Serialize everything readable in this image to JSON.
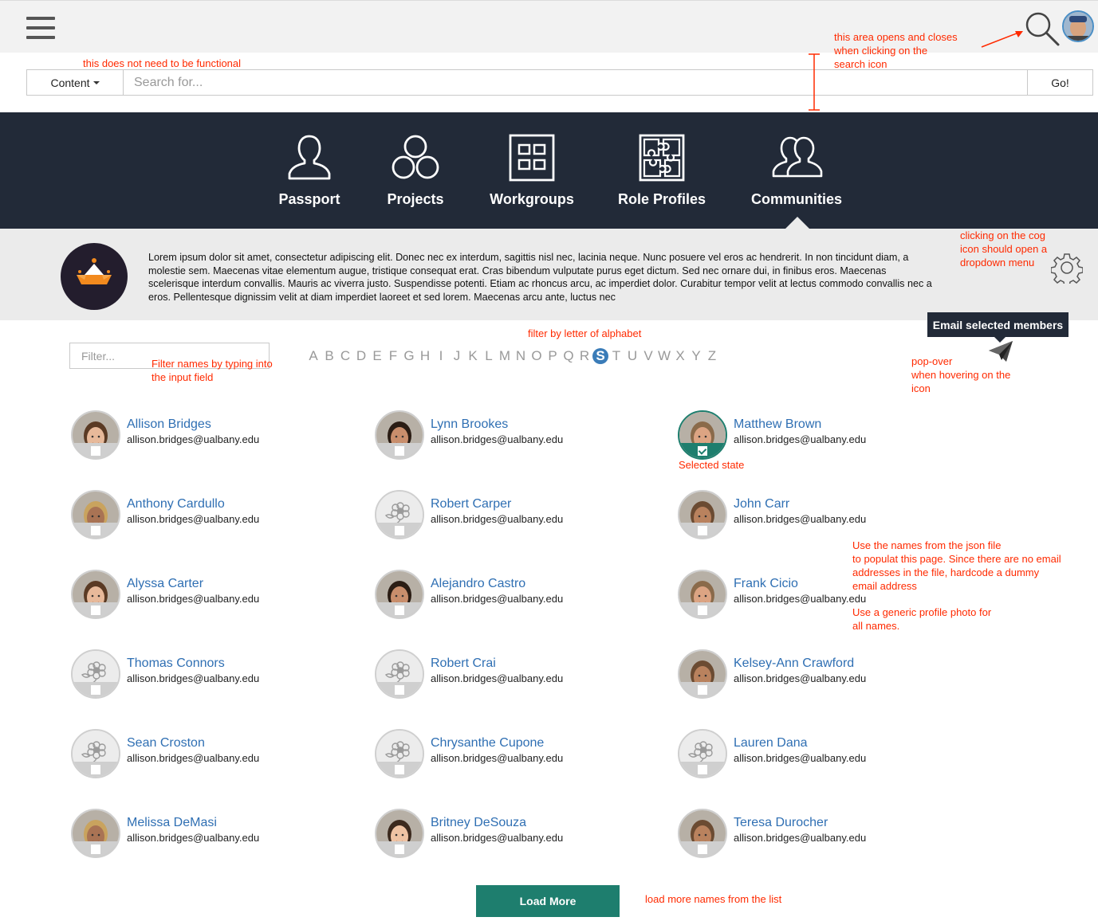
{
  "header": {
    "menu_icon": "hamburger-icon",
    "search_icon": "search-icon",
    "avatar_icon": "user-avatar"
  },
  "search": {
    "dropdown_label": "Content",
    "placeholder": "Search for...",
    "go_label": "Go!"
  },
  "nav": {
    "items": [
      {
        "label": "Passport",
        "icon": "person-icon"
      },
      {
        "label": "Projects",
        "icon": "circles-icon"
      },
      {
        "label": "Workgroups",
        "icon": "grid-icon"
      },
      {
        "label": "Role Profiles",
        "icon": "puzzle-icon"
      },
      {
        "label": "Communities",
        "icon": "people-icon"
      }
    ],
    "active": "Communities"
  },
  "community": {
    "description": "Lorem ipsum dolor sit amet, consectetur adipiscing elit. Donec nec ex interdum, sagittis nisl nec, lacinia neque. Nunc posuere vel eros ac hendrerit. In non tincidunt diam, a molestie sem. Maecenas vitae elementum augue, tristique consequat erat. Cras bibendum vulputate purus eget dictum. Sed nec ornare dui, in finibus eros. Maecenas scelerisque interdum convallis. Mauris ac viverra justo. Suspendisse potenti. Etiam ac rhoncus arcu, ac imperdiet dolor. Curabitur tempor velit at lectus commodo convallis nec a eros. Pellentesque dignissim velit at diam imperdiet laoreet et sed lorem. Maecenas arcu ante, luctus nec",
    "cog_icon": "gear-icon"
  },
  "filter": {
    "placeholder": "Filter...",
    "letters": [
      "A",
      "B",
      "C",
      "D",
      "E",
      "F",
      "G",
      "H",
      "I",
      "J",
      "K",
      "L",
      "M",
      "N",
      "O",
      "P",
      "Q",
      "R",
      "S",
      "T",
      "U",
      "V",
      "W",
      "X",
      "Y",
      "Z"
    ],
    "active_letter": "S"
  },
  "popover": {
    "label": "Email selected members",
    "icon": "paper-plane-icon"
  },
  "members": [
    {
      "name": "Allison Bridges",
      "email": "allison.bridges@ualbany.edu",
      "photo": "photo",
      "selected": false
    },
    {
      "name": "Lynn Brookes",
      "email": "allison.bridges@ualbany.edu",
      "photo": "photo",
      "selected": false
    },
    {
      "name": "Matthew Brown",
      "email": "allison.bridges@ualbany.edu",
      "photo": "photo",
      "selected": true
    },
    {
      "name": "Anthony Cardullo",
      "email": "allison.bridges@ualbany.edu",
      "photo": "photo",
      "selected": false
    },
    {
      "name": "Robert Carper",
      "email": "allison.bridges@ualbany.edu",
      "photo": "generic",
      "selected": false
    },
    {
      "name": "John Carr",
      "email": "allison.bridges@ualbany.edu",
      "photo": "photo",
      "selected": false
    },
    {
      "name": "Alyssa Carter",
      "email": "allison.bridges@ualbany.edu",
      "photo": "photo",
      "selected": false
    },
    {
      "name": "Alejandro Castro",
      "email": "allison.bridges@ualbany.edu",
      "photo": "photo",
      "selected": false
    },
    {
      "name": "Frank Cicio",
      "email": "allison.bridges@ualbany.edu",
      "photo": "photo",
      "selected": false
    },
    {
      "name": "Thomas Connors",
      "email": "allison.bridges@ualbany.edu",
      "photo": "generic",
      "selected": false
    },
    {
      "name": "Robert Crai",
      "email": "allison.bridges@ualbany.edu",
      "photo": "generic",
      "selected": false
    },
    {
      "name": "Kelsey-Ann Crawford",
      "email": "allison.bridges@ualbany.edu",
      "photo": "photo",
      "selected": false
    },
    {
      "name": "Sean Croston",
      "email": "allison.bridges@ualbany.edu",
      "photo": "generic",
      "selected": false
    },
    {
      "name": "Chrysanthe Cupone",
      "email": "allison.bridges@ualbany.edu",
      "photo": "generic",
      "selected": false
    },
    {
      "name": "Lauren Dana",
      "email": "allison.bridges@ualbany.edu",
      "photo": "generic",
      "selected": false
    },
    {
      "name": "Melissa DeMasi",
      "email": "allison.bridges@ualbany.edu",
      "photo": "photo",
      "selected": false
    },
    {
      "name": "Britney DeSouza",
      "email": "allison.bridges@ualbany.edu",
      "photo": "photo",
      "selected": false
    },
    {
      "name": "Teresa Durocher",
      "email": "allison.bridges@ualbany.edu",
      "photo": "photo",
      "selected": false
    }
  ],
  "load_more_label": "Load More",
  "annotations": {
    "search_area": "this area opens and closes\n when clicking on the\nsearch icon",
    "not_functional": "this does not need to be functional",
    "cog_menu": "clicking on the cog\nicon should open a\ndropdown menu",
    "alphabet_filter": "filter by letter of alphabet",
    "name_filter": "Filter names by typing into\nthe input field",
    "popover": "pop-over\nwhen hovering on the\nicon",
    "selected_state": "Selected state",
    "json_names": "Use the names from the json file\nto populat this page. Since there are no email\naddresses in the file, hardcode a dummy\nemail address",
    "generic_photo": "Use a generic profile photo for\nall names.",
    "load_more": "load more names from the list"
  },
  "colors": {
    "nav_bg": "#222a38",
    "accent_teal": "#1e7e6e",
    "link_blue": "#2f6fb3",
    "annotation_red": "#ff2a00"
  }
}
